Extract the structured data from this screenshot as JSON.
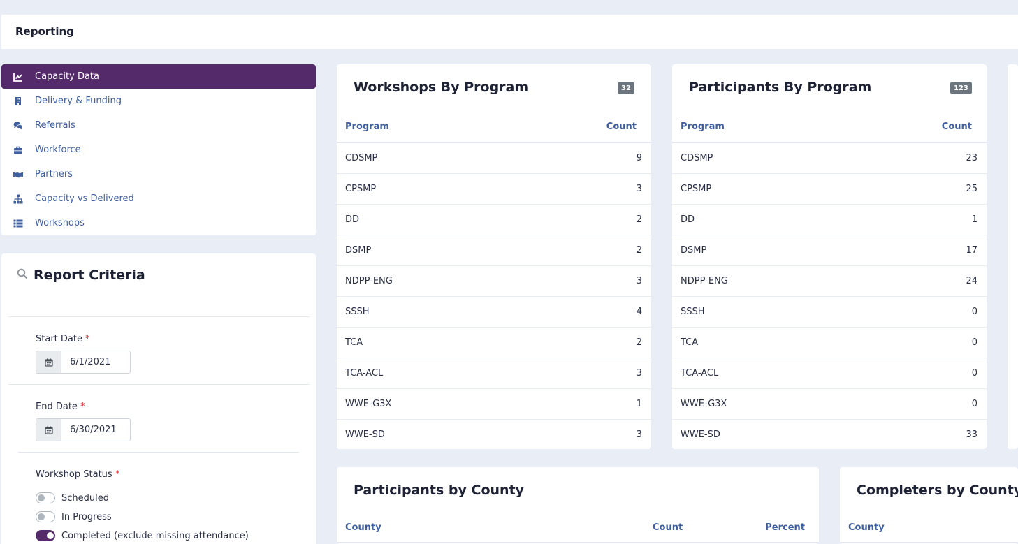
{
  "header": {
    "title": "Reporting"
  },
  "nav": {
    "items": [
      {
        "label": "Capacity Data",
        "icon": "chart-line-icon",
        "active": true
      },
      {
        "label": "Delivery & Funding",
        "icon": "building-icon"
      },
      {
        "label": "Referrals",
        "icon": "comments-icon"
      },
      {
        "label": "Workforce",
        "icon": "briefcase-icon"
      },
      {
        "label": "Partners",
        "icon": "handshake-icon"
      },
      {
        "label": "Capacity vs Delivered",
        "icon": "sitemap-icon"
      },
      {
        "label": "Workshops",
        "icon": "list-icon"
      }
    ]
  },
  "criteria": {
    "title": "Report Criteria",
    "start_date": {
      "label": "Start Date",
      "required": "*",
      "value": "6/1/2021"
    },
    "end_date": {
      "label": "End Date",
      "required": "*",
      "value": "6/30/2021"
    },
    "status": {
      "label": "Workshop Status",
      "required": "*",
      "options": [
        {
          "label": "Scheduled",
          "checked": false
        },
        {
          "label": "In Progress",
          "checked": false
        },
        {
          "label": "Completed (exclude missing attendance)",
          "checked": true
        }
      ]
    }
  },
  "workshops_by_program": {
    "title": "Workshops By Program",
    "badge": "32",
    "columns": [
      "Program",
      "Count"
    ],
    "rows": [
      [
        "CDSMP",
        "9"
      ],
      [
        "CPSMP",
        "3"
      ],
      [
        "DD",
        "2"
      ],
      [
        "DSMP",
        "2"
      ],
      [
        "NDPP-ENG",
        "3"
      ],
      [
        "SSSH",
        "4"
      ],
      [
        "TCA",
        "2"
      ],
      [
        "TCA-ACL",
        "3"
      ],
      [
        "WWE-G3X",
        "1"
      ],
      [
        "WWE-SD",
        "3"
      ]
    ]
  },
  "participants_by_program": {
    "title": "Participants By Program",
    "badge": "123",
    "columns": [
      "Program",
      "Count"
    ],
    "rows": [
      [
        "CDSMP",
        "23"
      ],
      [
        "CPSMP",
        "25"
      ],
      [
        "DD",
        "1"
      ],
      [
        "DSMP",
        "17"
      ],
      [
        "NDPP-ENG",
        "24"
      ],
      [
        "SSSH",
        "0"
      ],
      [
        "TCA",
        "0"
      ],
      [
        "TCA-ACL",
        "0"
      ],
      [
        "WWE-G3X",
        "0"
      ],
      [
        "WWE-SD",
        "33"
      ]
    ]
  },
  "participants_by_county": {
    "title": "Participants by County",
    "columns": [
      "County",
      "Count",
      "Percent"
    ]
  },
  "completers_by_county": {
    "title": "Completers by County",
    "columns": [
      "County"
    ]
  },
  "colors": {
    "accent": "#542a6b",
    "link": "#3f5f9e",
    "background": "#e9eef6"
  }
}
